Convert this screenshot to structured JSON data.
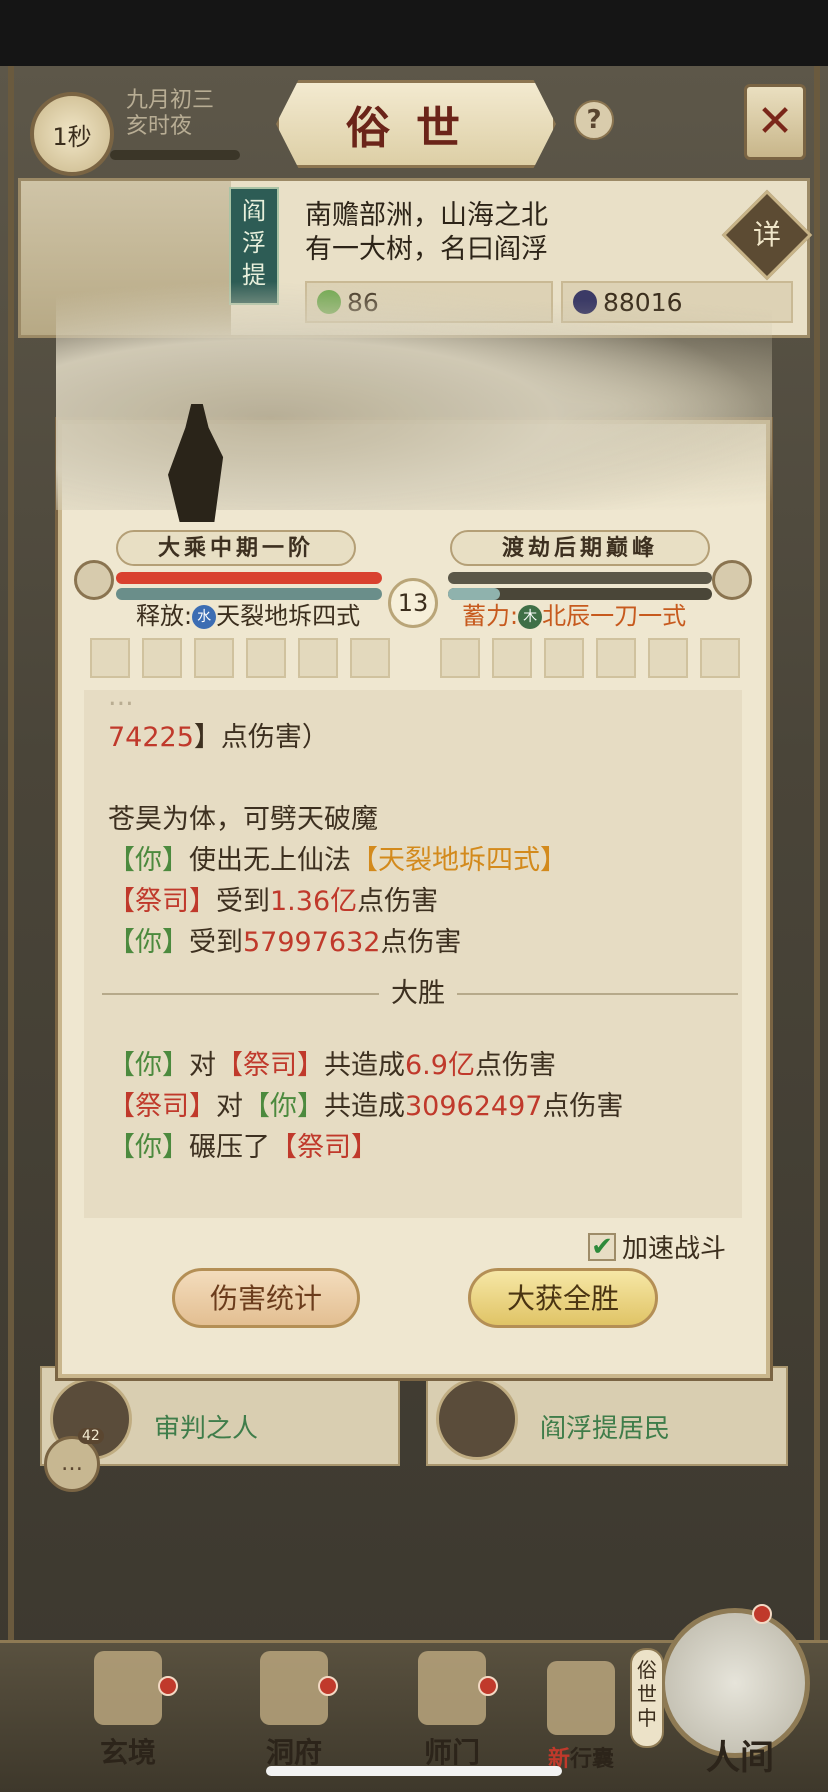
{
  "topbar": {
    "timer": "1秒",
    "date_line1": "九月初三",
    "date_line2": "亥时夜",
    "title": "俗世",
    "help": "?",
    "close": "✕"
  },
  "location": {
    "banner": "阎浮提",
    "desc_line1": "南赡部洲，山海之北",
    "desc_line2": "有一大树，名曰阎浮",
    "detail_label": "详",
    "resource1": "86",
    "resource2": "88016"
  },
  "battle": {
    "player_realm": "大乘中期一阶",
    "enemy_realm": "渡劫后期巅峰",
    "round": "13",
    "player_skill_prefix": "释放:",
    "player_skill_element": "水",
    "player_skill_name": "天裂地坼四式",
    "enemy_skill_prefix": "蓄力:",
    "enemy_skill_element": "木",
    "enemy_skill_name": "北辰一刀一式",
    "log": {
      "partial_line1": "...",
      "partial_num": "74225",
      "partial_text": "】点伤害）",
      "partial_bracket": "【",
      "flavor": "苍昊为体，可劈天破魔",
      "you": "你",
      "enemy": "祭司",
      "use_text": "使出无上仙法",
      "skill_name": "【天裂地坼四式】",
      "recv": "受到",
      "dmg_enemy": "1.36亿",
      "dmg_unit": "点伤害",
      "dmg_you": "57997632",
      "result": "大胜",
      "to": "对",
      "total_made": "共造成",
      "total_you": "6.9亿",
      "total_enemy": "30962497",
      "crushed": "碾压了"
    },
    "speed_up_label": "加速战斗",
    "btn_stats": "伤害统计",
    "btn_win": "大获全胜"
  },
  "cards": {
    "card1_name": "审判之人",
    "card2_name": "阎浮提居民",
    "chat_count": "42"
  },
  "nav": {
    "item1": "玄境",
    "item2": "洞府",
    "item3": "师门",
    "item4": "行囊",
    "item4_tag": "新",
    "item5": "人间",
    "status_tag": "俗世中"
  }
}
